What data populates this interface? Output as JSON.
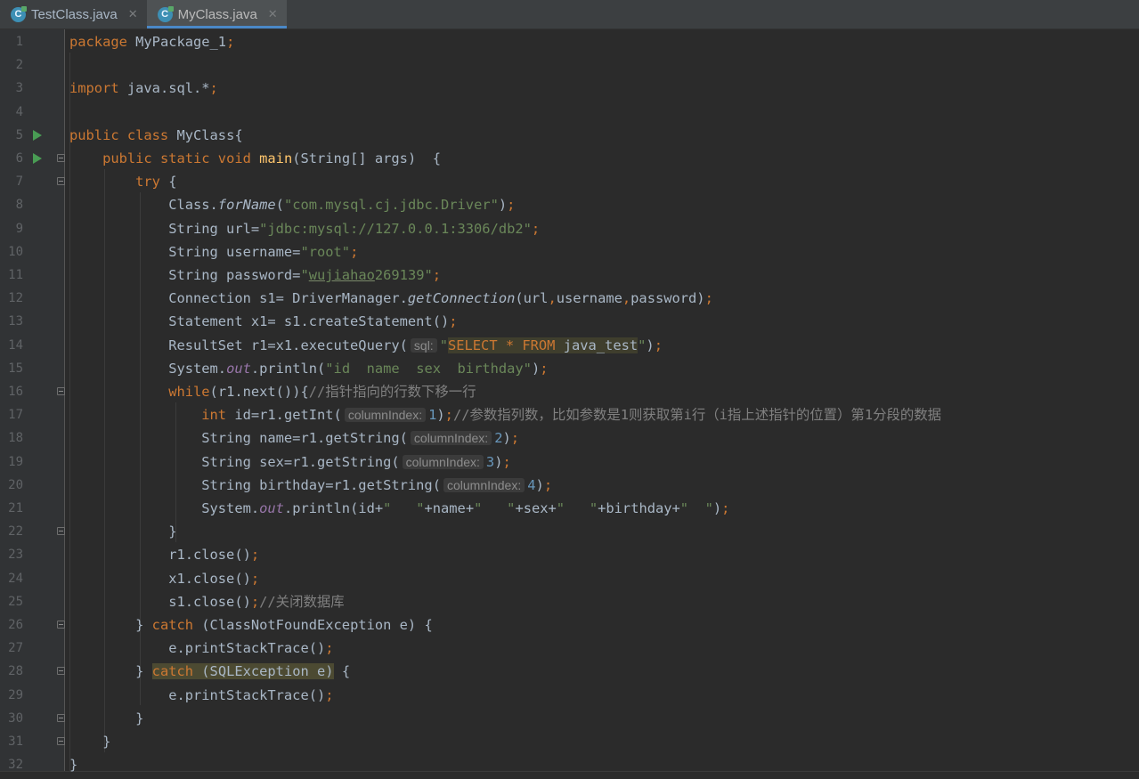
{
  "tabs": [
    {
      "label": "TestClass.java",
      "active": false,
      "icon": "java-class-icon"
    },
    {
      "label": "MyClass.java",
      "active": true,
      "icon": "java-class-icon"
    }
  ],
  "colors": {
    "background": "#2b2b2b",
    "keyword": "#cc7832",
    "string": "#6a8759",
    "number": "#6897bb",
    "method": "#ffc66d",
    "comment": "#808080",
    "field": "#9876aa"
  },
  "lines": [
    [
      [
        "kw",
        "package "
      ],
      [
        "t",
        "MyPackage_1"
      ],
      [
        "kw",
        ";"
      ]
    ],
    [],
    [
      [
        "kw",
        "import "
      ],
      [
        "t",
        "java.sql.*"
      ],
      [
        "kw",
        ";"
      ]
    ],
    [],
    [
      [
        "kw",
        "public class "
      ],
      [
        "t",
        "MyClass{"
      ]
    ],
    [
      [
        "t",
        "    "
      ],
      [
        "kw",
        "public static void "
      ],
      [
        "fn",
        "main"
      ],
      [
        "t",
        "(String[] args)  {"
      ]
    ],
    [
      [
        "t",
        "        "
      ],
      [
        "kw",
        "try "
      ],
      [
        "t",
        "{"
      ]
    ],
    [
      [
        "t",
        "            Class."
      ],
      [
        "it",
        "forName"
      ],
      [
        "t",
        "("
      ],
      [
        "str",
        "\"com.mysql.cj.jdbc.Driver\""
      ],
      [
        "t",
        ")"
      ],
      [
        "kw",
        ";"
      ]
    ],
    [
      [
        "t",
        "            String url="
      ],
      [
        "str",
        "\"jdbc:mysql://127.0.0.1:3306/db2\""
      ],
      [
        "kw",
        ";"
      ]
    ],
    [
      [
        "t",
        "            String username="
      ],
      [
        "str",
        "\"root\""
      ],
      [
        "kw",
        ";"
      ]
    ],
    [
      [
        "t",
        "            String password="
      ],
      [
        "str",
        "\""
      ],
      [
        "strU",
        "wujiahao"
      ],
      [
        "str",
        "269139\""
      ],
      [
        "kw",
        ";"
      ]
    ],
    [
      [
        "t",
        "            Connection s1= DriverManager."
      ],
      [
        "it",
        "getConnection"
      ],
      [
        "t",
        "(url"
      ],
      [
        "kw",
        ","
      ],
      [
        "t",
        "username"
      ],
      [
        "kw",
        ","
      ],
      [
        "t",
        "password)"
      ],
      [
        "kw",
        ";"
      ]
    ],
    [
      [
        "t",
        "            Statement x1= s1.createStatement()"
      ],
      [
        "kw",
        ";"
      ]
    ],
    [
      [
        "t",
        "            ResultSet r1=x1.executeQuery("
      ],
      [
        "hint",
        "sql:"
      ],
      [
        "str",
        "\""
      ],
      [
        "sqlkw",
        "SELECT * FROM "
      ],
      [
        "sqlt",
        "java_test"
      ],
      [
        "str",
        "\""
      ],
      [
        "t",
        ")"
      ],
      [
        "kw",
        ";"
      ]
    ],
    [
      [
        "t",
        "            System."
      ],
      [
        "fld",
        "out"
      ],
      [
        "t",
        ".println("
      ],
      [
        "str",
        "\"id  name  sex  birthday\""
      ],
      [
        "t",
        ")"
      ],
      [
        "kw",
        ";"
      ]
    ],
    [
      [
        "t",
        "            "
      ],
      [
        "kw",
        "while"
      ],
      [
        "t",
        "(r1.next()){"
      ],
      [
        "cmt",
        "//指针指向的行数下移一行"
      ]
    ],
    [
      [
        "t",
        "                "
      ],
      [
        "kw",
        "int "
      ],
      [
        "t",
        "id=r1.getInt("
      ],
      [
        "hint",
        "columnIndex:"
      ],
      [
        "num",
        "1"
      ],
      [
        "t",
        ")"
      ],
      [
        "kw",
        ";"
      ],
      [
        "cmt",
        "//参数指列数，比如参数是1则获取第i行（i指上述指针的位置）第1分段的数据"
      ]
    ],
    [
      [
        "t",
        "                String name=r1.getString("
      ],
      [
        "hint",
        "columnIndex:"
      ],
      [
        "num",
        "2"
      ],
      [
        "t",
        ")"
      ],
      [
        "kw",
        ";"
      ]
    ],
    [
      [
        "t",
        "                String sex=r1.getString("
      ],
      [
        "hint",
        "columnIndex:"
      ],
      [
        "num",
        "3"
      ],
      [
        "t",
        ")"
      ],
      [
        "kw",
        ";"
      ]
    ],
    [
      [
        "t",
        "                String birthday=r1.getString("
      ],
      [
        "hint",
        "columnIndex:"
      ],
      [
        "num",
        "4"
      ],
      [
        "t",
        ")"
      ],
      [
        "kw",
        ";"
      ]
    ],
    [
      [
        "t",
        "                System."
      ],
      [
        "fld",
        "out"
      ],
      [
        "t",
        ".println(id+"
      ],
      [
        "str",
        "\"   \""
      ],
      [
        "t",
        "+name+"
      ],
      [
        "str",
        "\"   \""
      ],
      [
        "t",
        "+sex+"
      ],
      [
        "str",
        "\"   \""
      ],
      [
        "t",
        "+birthday+"
      ],
      [
        "str",
        "\"  \""
      ],
      [
        "t",
        ")"
      ],
      [
        "kw",
        ";"
      ]
    ],
    [
      [
        "t",
        "            }"
      ]
    ],
    [
      [
        "t",
        "            r1.close()"
      ],
      [
        "kw",
        ";"
      ]
    ],
    [
      [
        "t",
        "            x1.close()"
      ],
      [
        "kw",
        ";"
      ]
    ],
    [
      [
        "t",
        "            s1.close()"
      ],
      [
        "kw",
        ";"
      ],
      [
        "cmt",
        "//关闭数据库"
      ]
    ],
    [
      [
        "t",
        "        } "
      ],
      [
        "kw",
        "catch "
      ],
      [
        "t",
        "(ClassNotFoundException e) {"
      ]
    ],
    [
      [
        "t",
        "            e.printStackTrace()"
      ],
      [
        "kw",
        ";"
      ]
    ],
    [
      [
        "t",
        "        } "
      ],
      [
        "kwH",
        "catch "
      ],
      [
        "tH",
        "(SQLException e)"
      ],
      [
        "t",
        " {"
      ]
    ],
    [
      [
        "t",
        "            e.printStackTrace()"
      ],
      [
        "kw",
        ";"
      ]
    ],
    [
      [
        "t",
        "        }"
      ]
    ],
    [
      [
        "t",
        "    }"
      ]
    ],
    [
      [
        "t",
        "}"
      ]
    ]
  ],
  "line_numbers": [
    "1",
    "2",
    "3",
    "4",
    "5",
    "6",
    "7",
    "8",
    "9",
    "10",
    "11",
    "12",
    "13",
    "14",
    "15",
    "16",
    "17",
    "18",
    "19",
    "20",
    "21",
    "22",
    "23",
    "24",
    "25",
    "26",
    "27",
    "28",
    "29",
    "30",
    "31",
    "32"
  ],
  "run_icon_lines": [
    5,
    6
  ],
  "fold_lines": [
    6,
    7,
    16,
    22,
    26,
    28,
    30,
    31
  ]
}
